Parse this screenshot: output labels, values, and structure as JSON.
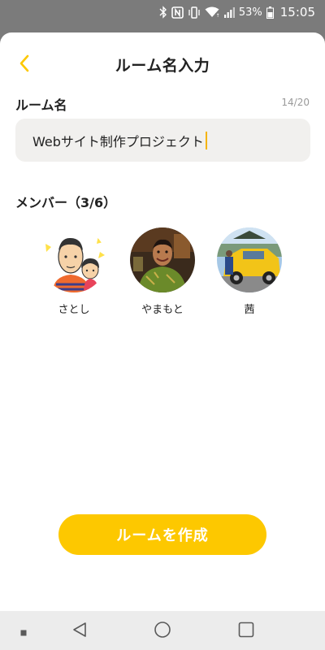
{
  "status_bar": {
    "battery_percent": "53%",
    "time": "15:05",
    "icons": [
      "bluetooth-icon",
      "nfc-icon",
      "vibrate-icon",
      "wifi-icon",
      "signal-icon",
      "battery-icon"
    ]
  },
  "header": {
    "title": "ルーム名入力",
    "back_icon": "chevron-left-icon"
  },
  "room_name": {
    "label": "ルーム名",
    "counter": "14/20",
    "value": "Webサイト制作プロジェクト"
  },
  "members": {
    "heading": "メンバー（3/6）",
    "items": [
      {
        "name": "さとし"
      },
      {
        "name": "やまもと"
      },
      {
        "name": "茜"
      }
    ]
  },
  "create_button": {
    "label": "ルームを作成"
  },
  "nav_bar": {
    "icons": [
      "recent-dot-icon",
      "back-triangle-icon",
      "home-circle-icon",
      "overview-square-icon"
    ]
  },
  "colors": {
    "accent": "#fdc800",
    "input_bg": "#f1f0ee",
    "status_bar_bg": "#7b7b7b",
    "nav_bar_bg": "#ececec"
  }
}
